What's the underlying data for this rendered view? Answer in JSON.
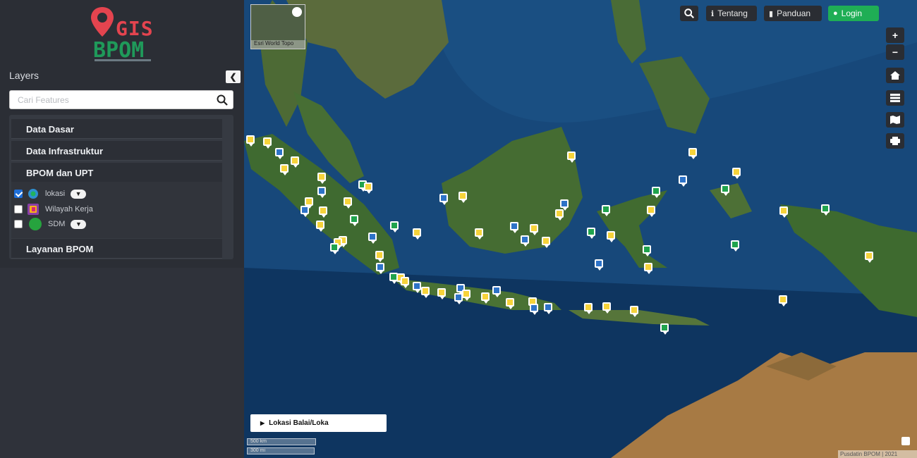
{
  "logo": {
    "line1": "GIS",
    "line2": "BPOM",
    "pin_color": "#e4444f",
    "brand_green": "#1f9a5a"
  },
  "sidebar": {
    "title": "Layers",
    "collapse_icon": "chevron-left-icon",
    "search": {
      "placeholder": "Cari Features",
      "value": ""
    },
    "groups": [
      {
        "label": "Data Dasar"
      },
      {
        "label": "Data Infrastruktur"
      },
      {
        "label": "BPOM dan UPT",
        "expanded": true,
        "layers": [
          {
            "label": "lokasi",
            "checked": true,
            "filter": true
          },
          {
            "label": "Wilayah Kerja",
            "checked": false,
            "filter": false
          },
          {
            "label": "SDM",
            "checked": false,
            "filter": true
          }
        ]
      },
      {
        "label": "Layanan BPOM"
      }
    ]
  },
  "toolbar": {
    "search_icon": "search-icon",
    "about_label": "Tentang",
    "guide_label": "Panduan",
    "login_label": "Login"
  },
  "map_controls": {
    "zoom_in": "+",
    "zoom_out": "−"
  },
  "minimap": {
    "label": "Esri World Topo"
  },
  "legend": {
    "label": "Lokasi Balai/Loka"
  },
  "scale": {
    "km": "500 km",
    "mi": "300 mi"
  },
  "attribution": "Pusdatin BPOM | 2021",
  "colors": {
    "marker_yellow": "#f6d33b",
    "marker_blue": "#2e73c8",
    "marker_green": "#20a34d",
    "login_green": "#1fae55"
  }
}
